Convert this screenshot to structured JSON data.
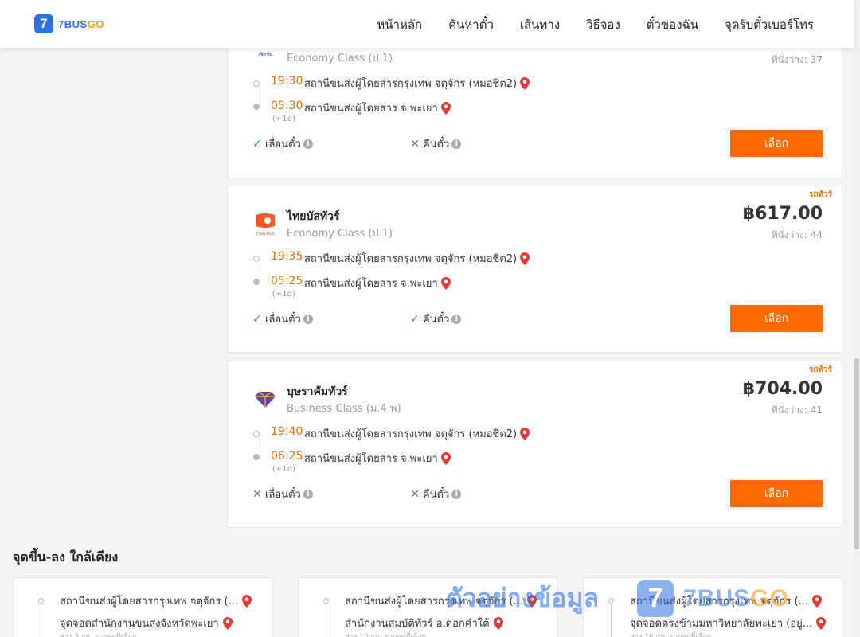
{
  "header": {
    "logo_digit": "7",
    "logo_brand_a": "7BUS",
    "logo_brand_b": "GO",
    "nav": [
      "หน้าหลัก",
      "ค้นหาตั๋ว",
      "เส้นทาง",
      "วิธีจอง",
      "ตั๋วของฉัน",
      "จุดรับตั๋วเบอร์โทร"
    ]
  },
  "trips": [
    {
      "operator": "",
      "class": "Economy Class (ป.1)",
      "price": "",
      "seats": "ที่นั่งว่าง: 37",
      "ribbon": "",
      "depart_time": "19:30",
      "depart_station": "สถานีขนส่งผู้โดยสารกรุงเทพ จตุจักร (หมอชิต2)",
      "arrive_time": "05:30",
      "arrive_station": "สถานีขนส่งผู้โดยสาร จ.พะเยา",
      "next_day": "(+1d)",
      "reschedule_label": "เลื่อนตั๋ว",
      "reschedule_allowed": true,
      "refund_label": "คืนตั๋ว",
      "refund_allowed": false,
      "button": "เลือก"
    },
    {
      "operator": "ไทยบัสทัวร์",
      "class": "Economy Class (ป.1)",
      "price": "฿617.00",
      "seats": "ที่นั่งว่าง: 44",
      "ribbon": "รถทัวร์",
      "depart_time": "19:35",
      "depart_station": "สถานีขนส่งผู้โดยสารกรุงเทพ จตุจักร (หมอชิต2)",
      "arrive_time": "05:25",
      "arrive_station": "สถานีขนส่งผู้โดยสาร จ.พะเยา",
      "next_day": "(+1d)",
      "reschedule_label": "เลื่อนตั๋ว",
      "reschedule_allowed": true,
      "refund_label": "คืนตั๋ว",
      "refund_allowed": true,
      "button": "เลือก"
    },
    {
      "operator": "บุษราคัมทัวร์",
      "class": "Business Class (ม.4 พ)",
      "price": "฿704.00",
      "seats": "ที่นั่งว่าง: 41",
      "ribbon": "รถทัวร์",
      "depart_time": "19:40",
      "depart_station": "สถานีขนส่งผู้โดยสารกรุงเทพ จตุจักร (หมอชิต2)",
      "arrive_time": "06:25",
      "arrive_station": "สถานีขนส่งผู้โดยสาร จ.พะเยา",
      "next_day": "(+1d)",
      "reschedule_label": "เลื่อนตั๋ว",
      "reschedule_allowed": false,
      "refund_label": "คืนตั๋ว",
      "refund_allowed": false,
      "button": "เลือก"
    }
  ],
  "nearby": {
    "title": "จุดขึ้น-ลง ใกล้เคียง",
    "items": [
      {
        "from": "สถานีขนส่งผู้โดยสารกรุงเทพ จตุจักร (...",
        "to": "จุดจอดสำนักงานขนส่งจังหวัดพะเยา",
        "distance": "ห่าง 3 กม. จากจุดที่เลือก"
      },
      {
        "from": "สถานีขนส่งผู้โดยสารกรุงเทพ จตุจักร (...",
        "to": "สำนักงานสมบัติทัวร์ อ.ดอกคำใต้",
        "distance": "ห่าง 10 กม. จากจุดที่เลือก"
      },
      {
        "from": "สถานีขนส่งผู้โดยสารกรุงเทพ จตุจักร (...",
        "to": "จุดจอดตรงข้ามมหาวิทยาลัยพะเยา (อยู่...",
        "distance": "ห่าง 16 กม. จากจุดที่เลือก"
      }
    ]
  },
  "watermark": {
    "text": "ตัวอย่างข้อมูล",
    "digit": "7",
    "brand_a": "7BUS",
    "brand_b": "GO"
  },
  "colors": {
    "accent": "#ff6a00",
    "brand_blue": "#2f6fe4",
    "brand_orange": "#f39a1c",
    "time": "#f36b00"
  }
}
